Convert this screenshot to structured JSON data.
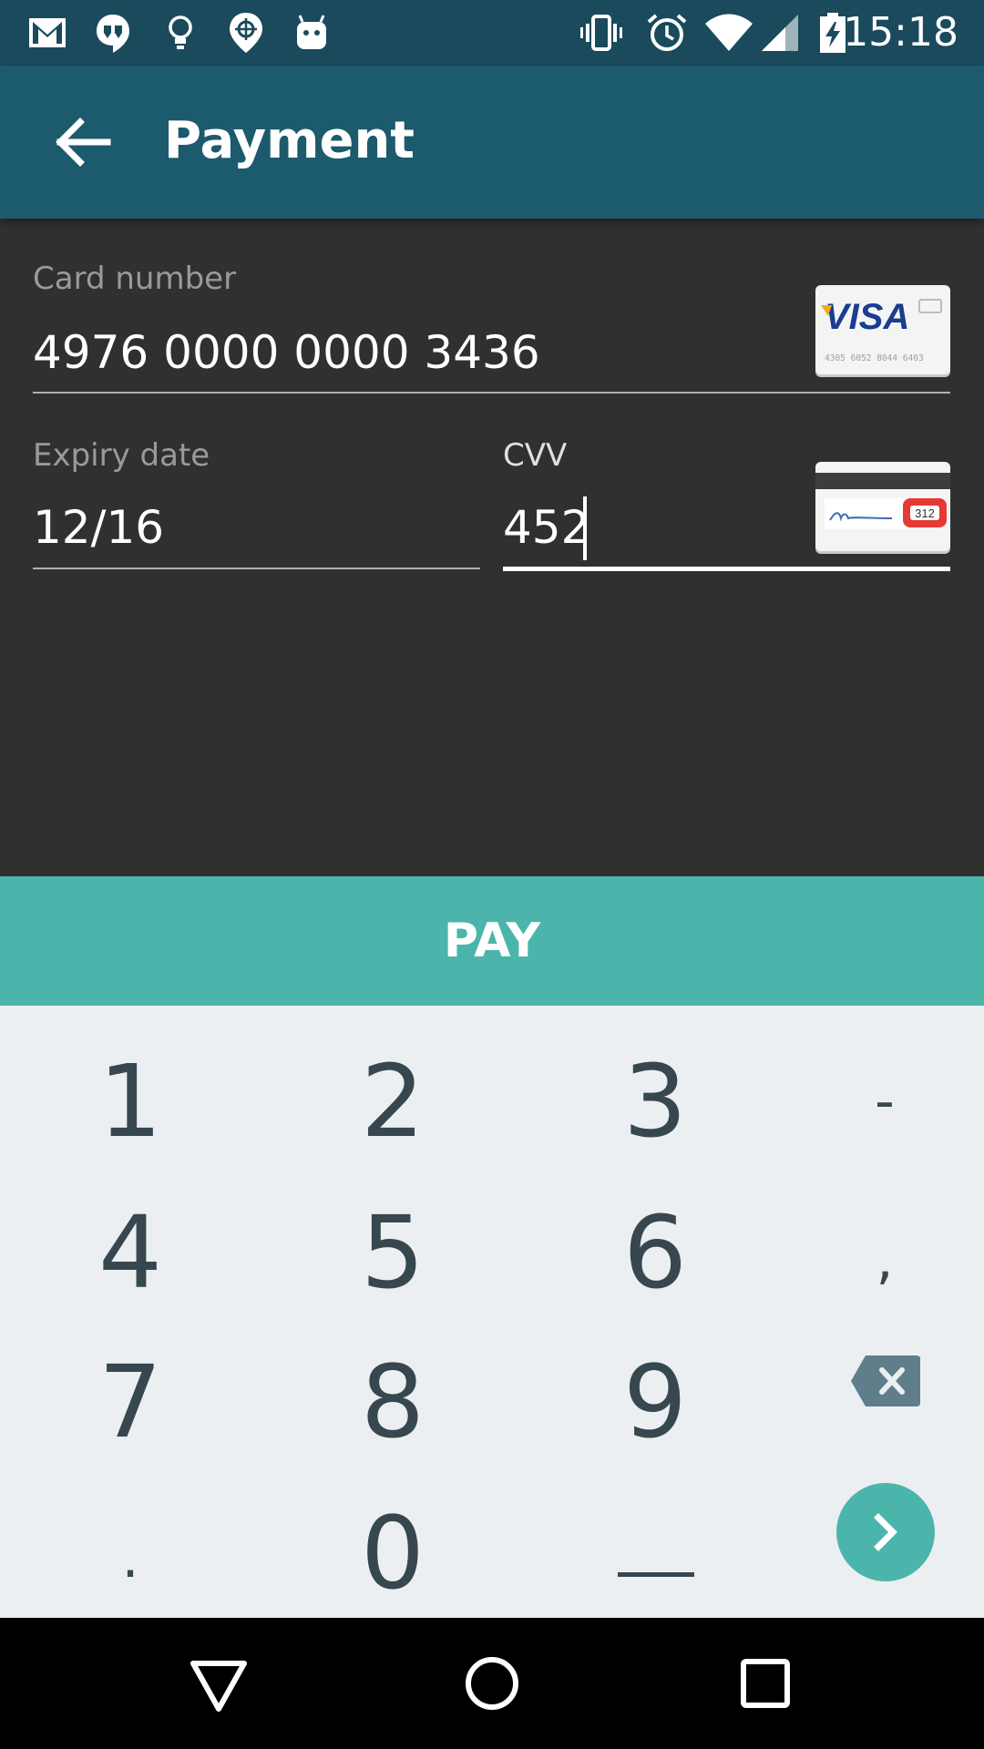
{
  "status_bar": {
    "time": "15:18",
    "left_icons": [
      "gmail-icon",
      "hangouts-icon",
      "lightbulb-icon",
      "location-pin-icon",
      "android-icon"
    ],
    "right_icons": [
      "vibrate-icon",
      "alarm-icon",
      "wifi-icon",
      "signal-icon",
      "battery-charging-icon"
    ]
  },
  "app_bar": {
    "title": "Payment",
    "back_icon": "arrow-back-icon"
  },
  "form": {
    "card_number": {
      "label": "Card number",
      "value": "4976 0000 0000 3436"
    },
    "card_brand": {
      "name": "VISA",
      "sample_number": "4305 6052 8044 6403"
    },
    "expiry": {
      "label": "Expiry date",
      "value": "12/16"
    },
    "cvv": {
      "label": "CVV",
      "value": "452",
      "hint_code": "312"
    }
  },
  "pay_button": {
    "label": "PAY"
  },
  "keyboard": {
    "keys": [
      "1",
      "2",
      "3",
      "-",
      "4",
      "5",
      "6",
      ",",
      "7",
      "8",
      "9",
      "backspace",
      ".",
      "0",
      "space",
      "go"
    ]
  },
  "nav_bar": {
    "icons": [
      "back-triangle-icon",
      "home-circle-icon",
      "recents-square-icon"
    ]
  },
  "colors": {
    "status_bar": "#1a4a5c",
    "app_bar": "#1c5a6e",
    "background": "#303030",
    "accent": "#4bb5ab",
    "keyboard_bg": "#eceff1",
    "key_text": "#37474f"
  }
}
